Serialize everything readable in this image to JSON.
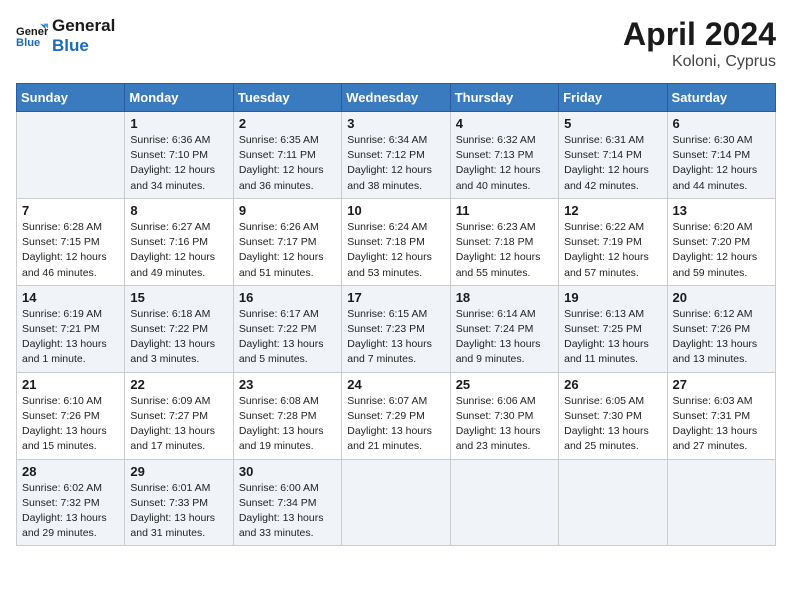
{
  "logo": {
    "line1": "General",
    "line2": "Blue"
  },
  "title": "April 2024",
  "subtitle": "Koloni, Cyprus",
  "days_of_week": [
    "Sunday",
    "Monday",
    "Tuesday",
    "Wednesday",
    "Thursday",
    "Friday",
    "Saturday"
  ],
  "weeks": [
    [
      {
        "num": "",
        "info": ""
      },
      {
        "num": "1",
        "info": "Sunrise: 6:36 AM\nSunset: 7:10 PM\nDaylight: 12 hours\nand 34 minutes."
      },
      {
        "num": "2",
        "info": "Sunrise: 6:35 AM\nSunset: 7:11 PM\nDaylight: 12 hours\nand 36 minutes."
      },
      {
        "num": "3",
        "info": "Sunrise: 6:34 AM\nSunset: 7:12 PM\nDaylight: 12 hours\nand 38 minutes."
      },
      {
        "num": "4",
        "info": "Sunrise: 6:32 AM\nSunset: 7:13 PM\nDaylight: 12 hours\nand 40 minutes."
      },
      {
        "num": "5",
        "info": "Sunrise: 6:31 AM\nSunset: 7:14 PM\nDaylight: 12 hours\nand 42 minutes."
      },
      {
        "num": "6",
        "info": "Sunrise: 6:30 AM\nSunset: 7:14 PM\nDaylight: 12 hours\nand 44 minutes."
      }
    ],
    [
      {
        "num": "7",
        "info": "Sunrise: 6:28 AM\nSunset: 7:15 PM\nDaylight: 12 hours\nand 46 minutes."
      },
      {
        "num": "8",
        "info": "Sunrise: 6:27 AM\nSunset: 7:16 PM\nDaylight: 12 hours\nand 49 minutes."
      },
      {
        "num": "9",
        "info": "Sunrise: 6:26 AM\nSunset: 7:17 PM\nDaylight: 12 hours\nand 51 minutes."
      },
      {
        "num": "10",
        "info": "Sunrise: 6:24 AM\nSunset: 7:18 PM\nDaylight: 12 hours\nand 53 minutes."
      },
      {
        "num": "11",
        "info": "Sunrise: 6:23 AM\nSunset: 7:18 PM\nDaylight: 12 hours\nand 55 minutes."
      },
      {
        "num": "12",
        "info": "Sunrise: 6:22 AM\nSunset: 7:19 PM\nDaylight: 12 hours\nand 57 minutes."
      },
      {
        "num": "13",
        "info": "Sunrise: 6:20 AM\nSunset: 7:20 PM\nDaylight: 12 hours\nand 59 minutes."
      }
    ],
    [
      {
        "num": "14",
        "info": "Sunrise: 6:19 AM\nSunset: 7:21 PM\nDaylight: 13 hours\nand 1 minute."
      },
      {
        "num": "15",
        "info": "Sunrise: 6:18 AM\nSunset: 7:22 PM\nDaylight: 13 hours\nand 3 minutes."
      },
      {
        "num": "16",
        "info": "Sunrise: 6:17 AM\nSunset: 7:22 PM\nDaylight: 13 hours\nand 5 minutes."
      },
      {
        "num": "17",
        "info": "Sunrise: 6:15 AM\nSunset: 7:23 PM\nDaylight: 13 hours\nand 7 minutes."
      },
      {
        "num": "18",
        "info": "Sunrise: 6:14 AM\nSunset: 7:24 PM\nDaylight: 13 hours\nand 9 minutes."
      },
      {
        "num": "19",
        "info": "Sunrise: 6:13 AM\nSunset: 7:25 PM\nDaylight: 13 hours\nand 11 minutes."
      },
      {
        "num": "20",
        "info": "Sunrise: 6:12 AM\nSunset: 7:26 PM\nDaylight: 13 hours\nand 13 minutes."
      }
    ],
    [
      {
        "num": "21",
        "info": "Sunrise: 6:10 AM\nSunset: 7:26 PM\nDaylight: 13 hours\nand 15 minutes."
      },
      {
        "num": "22",
        "info": "Sunrise: 6:09 AM\nSunset: 7:27 PM\nDaylight: 13 hours\nand 17 minutes."
      },
      {
        "num": "23",
        "info": "Sunrise: 6:08 AM\nSunset: 7:28 PM\nDaylight: 13 hours\nand 19 minutes."
      },
      {
        "num": "24",
        "info": "Sunrise: 6:07 AM\nSunset: 7:29 PM\nDaylight: 13 hours\nand 21 minutes."
      },
      {
        "num": "25",
        "info": "Sunrise: 6:06 AM\nSunset: 7:30 PM\nDaylight: 13 hours\nand 23 minutes."
      },
      {
        "num": "26",
        "info": "Sunrise: 6:05 AM\nSunset: 7:30 PM\nDaylight: 13 hours\nand 25 minutes."
      },
      {
        "num": "27",
        "info": "Sunrise: 6:03 AM\nSunset: 7:31 PM\nDaylight: 13 hours\nand 27 minutes."
      }
    ],
    [
      {
        "num": "28",
        "info": "Sunrise: 6:02 AM\nSunset: 7:32 PM\nDaylight: 13 hours\nand 29 minutes."
      },
      {
        "num": "29",
        "info": "Sunrise: 6:01 AM\nSunset: 7:33 PM\nDaylight: 13 hours\nand 31 minutes."
      },
      {
        "num": "30",
        "info": "Sunrise: 6:00 AM\nSunset: 7:34 PM\nDaylight: 13 hours\nand 33 minutes."
      },
      {
        "num": "",
        "info": ""
      },
      {
        "num": "",
        "info": ""
      },
      {
        "num": "",
        "info": ""
      },
      {
        "num": "",
        "info": ""
      }
    ]
  ]
}
